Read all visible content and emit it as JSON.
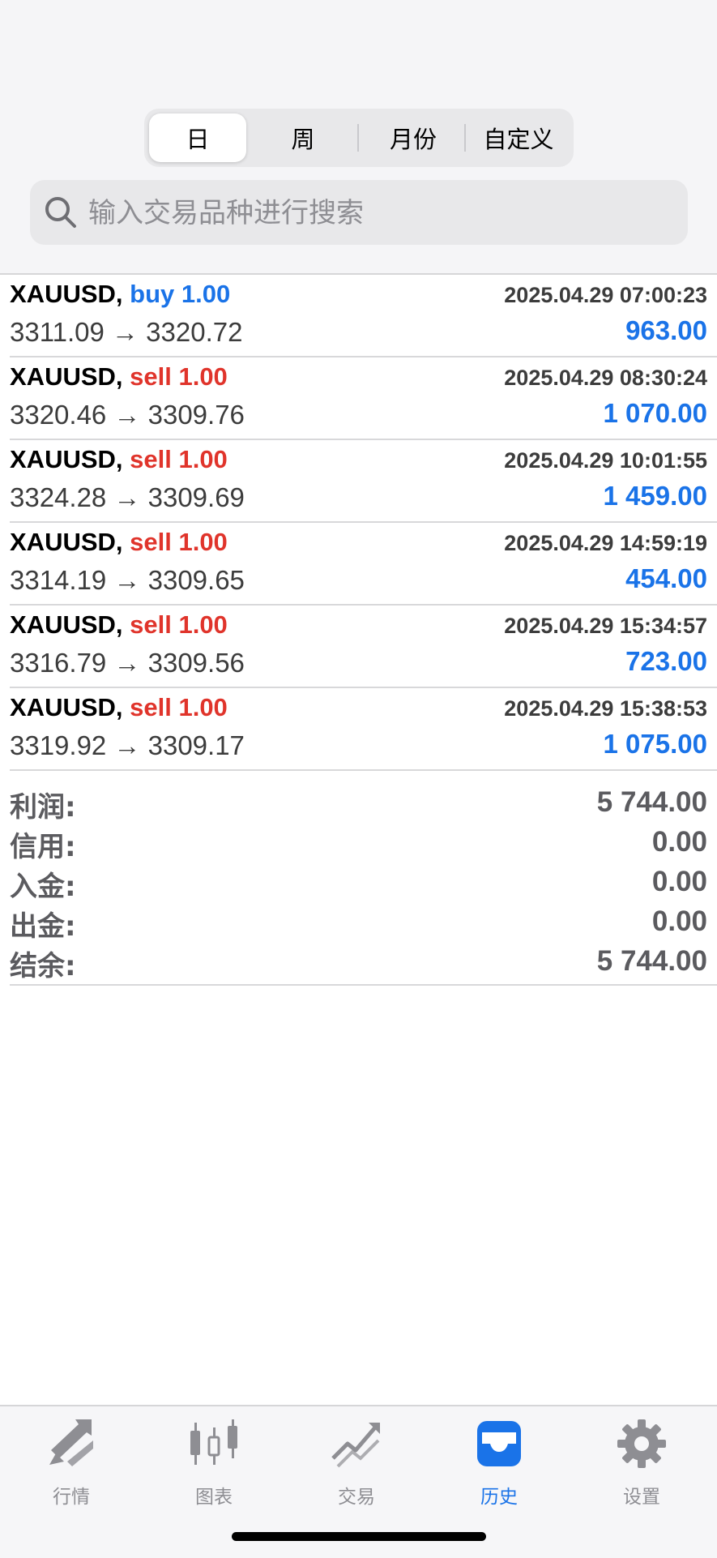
{
  "period_tabs": [
    "日",
    "周",
    "月份",
    "自定义"
  ],
  "active_period": "日",
  "search": {
    "placeholder": "输入交易品种进行搜索"
  },
  "deals": [
    {
      "symbol": "XAUUSD,",
      "type": "buy",
      "volume_text": "buy 1.00",
      "time": "2025.04.29 07:00:23",
      "prices": "3311.09 → 3320.72",
      "profit": "963.00"
    },
    {
      "symbol": "XAUUSD,",
      "type": "sell",
      "volume_text": "sell 1.00",
      "time": "2025.04.29 08:30:24",
      "prices": "3320.46 → 3309.76",
      "profit": "1 070.00"
    },
    {
      "symbol": "XAUUSD,",
      "type": "sell",
      "volume_text": "sell 1.00",
      "time": "2025.04.29 10:01:55",
      "prices": "3324.28 → 3309.69",
      "profit": "1 459.00"
    },
    {
      "symbol": "XAUUSD,",
      "type": "sell",
      "volume_text": "sell 1.00",
      "time": "2025.04.29 14:59:19",
      "prices": "3314.19 → 3309.65",
      "profit": "454.00"
    },
    {
      "symbol": "XAUUSD,",
      "type": "sell",
      "volume_text": "sell 1.00",
      "time": "2025.04.29 15:34:57",
      "prices": "3316.79 → 3309.56",
      "profit": "723.00"
    },
    {
      "symbol": "XAUUSD,",
      "type": "sell",
      "volume_text": "sell 1.00",
      "time": "2025.04.29 15:38:53",
      "prices": "3319.92 → 3309.17",
      "profit": "1 075.00"
    }
  ],
  "summary": [
    {
      "label": "利润:",
      "value": "5 744.00"
    },
    {
      "label": "信用:",
      "value": "0.00"
    },
    {
      "label": "入金:",
      "value": "0.00"
    },
    {
      "label": "出金:",
      "value": "0.00"
    },
    {
      "label": "结余:",
      "value": "5 744.00"
    }
  ],
  "tabbar": [
    {
      "label": "行情",
      "icon": "quotes-arrows-icon"
    },
    {
      "label": "图表",
      "icon": "candlestick-chart-icon"
    },
    {
      "label": "交易",
      "icon": "trade-trend-icon"
    },
    {
      "label": "历史",
      "icon": "history-inbox-icon"
    },
    {
      "label": "设置",
      "icon": "gear-icon"
    }
  ],
  "active_tab": "历史",
  "colors": {
    "accent": "#1a73e8",
    "sell": "#e0342b",
    "buy": "#1a73e8",
    "inactive_icon": "#8e8e93"
  }
}
